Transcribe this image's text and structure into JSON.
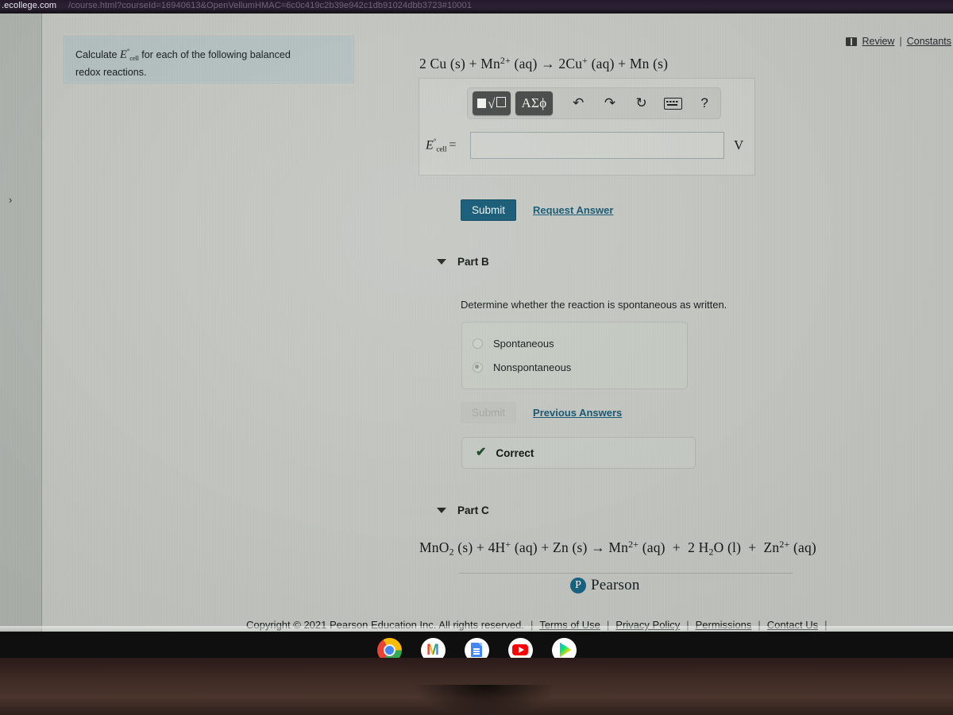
{
  "browser": {
    "url_domain": ".ecollege.com",
    "url_path": "/course.html?courseId=16940613&OpenVellumHMAC=6c0c419c2b39e942c1db91024dbb3723#10001"
  },
  "header": {
    "book_icon": "book-icon",
    "review_label": "Review",
    "separator": "|",
    "constants_label": "Constants"
  },
  "sidebar": {
    "expand_chevron": "›"
  },
  "prompt": {
    "line1_pre": "Calculate ",
    "symbol": "E",
    "symbol_sup": "°",
    "symbol_sub": "cell",
    "line1_post": " for each of the following balanced",
    "line2": "redox reactions."
  },
  "parts": [
    {
      "id": "A",
      "equation": {
        "html": "2 Cu (s) + Mn<sup>2+</sup> (aq) &rarr; 2Cu<sup>+</sup> (aq) + Mn (s)",
        "plain": "2 Cu (s) + Mn2+ (aq) -> 2Cu+ (aq) + Mn (s)"
      },
      "math_toolbar": {
        "buttons": [
          {
            "name": "template-sqrt-button",
            "label": "■√□"
          },
          {
            "name": "greek-symbols-button",
            "label": "ΑΣϕ"
          }
        ],
        "icons": [
          {
            "name": "undo-icon",
            "glyph": "↶"
          },
          {
            "name": "redo-icon",
            "glyph": "↷"
          },
          {
            "name": "reset-icon",
            "glyph": "↻"
          },
          {
            "name": "keyboard-icon",
            "glyph": "keyboard"
          },
          {
            "name": "help-icon",
            "glyph": "?"
          }
        ]
      },
      "answer": {
        "label_symbol": "E",
        "label_sup": "°",
        "label_sub": "cell",
        "equals": "=",
        "value": "",
        "placeholder": "",
        "unit": "V"
      },
      "actions": {
        "submit_label": "Submit",
        "submit_disabled": false,
        "link_label": "Request Answer"
      }
    },
    {
      "id": "B",
      "title": "Part B",
      "question": "Determine whether the reaction is spontaneous as written.",
      "options": [
        {
          "label": "Spontaneous",
          "selected": false
        },
        {
          "label": "Nonspontaneous",
          "selected": true
        }
      ],
      "actions": {
        "submit_label": "Submit",
        "submit_disabled": true,
        "link_label": "Previous Answers"
      },
      "feedback": {
        "icon": "check-icon",
        "label": "Correct"
      }
    },
    {
      "id": "C",
      "title": "Part C",
      "equation": {
        "html": "MnO<sub>2</sub> (s) + 4H<sup>+</sup> (aq) + Zn (s) &rarr; Mn<sup>2+</sup> (aq) &nbsp;+&nbsp; 2 H<sub>2</sub>O (l) &nbsp;+&nbsp; Zn<sup>2+</sup> (aq)",
        "plain": "MnO2 (s) + 4H+ (aq) + Zn (s) -> Mn2+ (aq) + 2 H2O (l) + Zn2+ (aq)"
      }
    }
  ],
  "footer": {
    "logo_mark": "P",
    "logo_word": "Pearson",
    "copyright": "Copyright © 2021 Pearson Education Inc. All rights reserved.",
    "links": [
      "Terms of Use",
      "Privacy Policy",
      "Permissions",
      "Contact Us"
    ],
    "separator": "|"
  },
  "shelf": {
    "items": [
      {
        "name": "chrome-icon",
        "label": "Chrome",
        "active": true
      },
      {
        "name": "gmail-icon",
        "label": "Gmail",
        "active": false
      },
      {
        "name": "docs-icon",
        "label": "Docs",
        "active": false
      },
      {
        "name": "youtube-icon",
        "label": "YouTube",
        "active": false
      },
      {
        "name": "play-store-icon",
        "label": "Play Store",
        "active": false
      }
    ]
  },
  "colors": {
    "accent_teal": "#1d5b74",
    "page_bg": "#c3c6c1",
    "prompt_bg": "#b6c1c1",
    "correct_green": "#23512f",
    "pearson_blue": "#1a6a88"
  }
}
